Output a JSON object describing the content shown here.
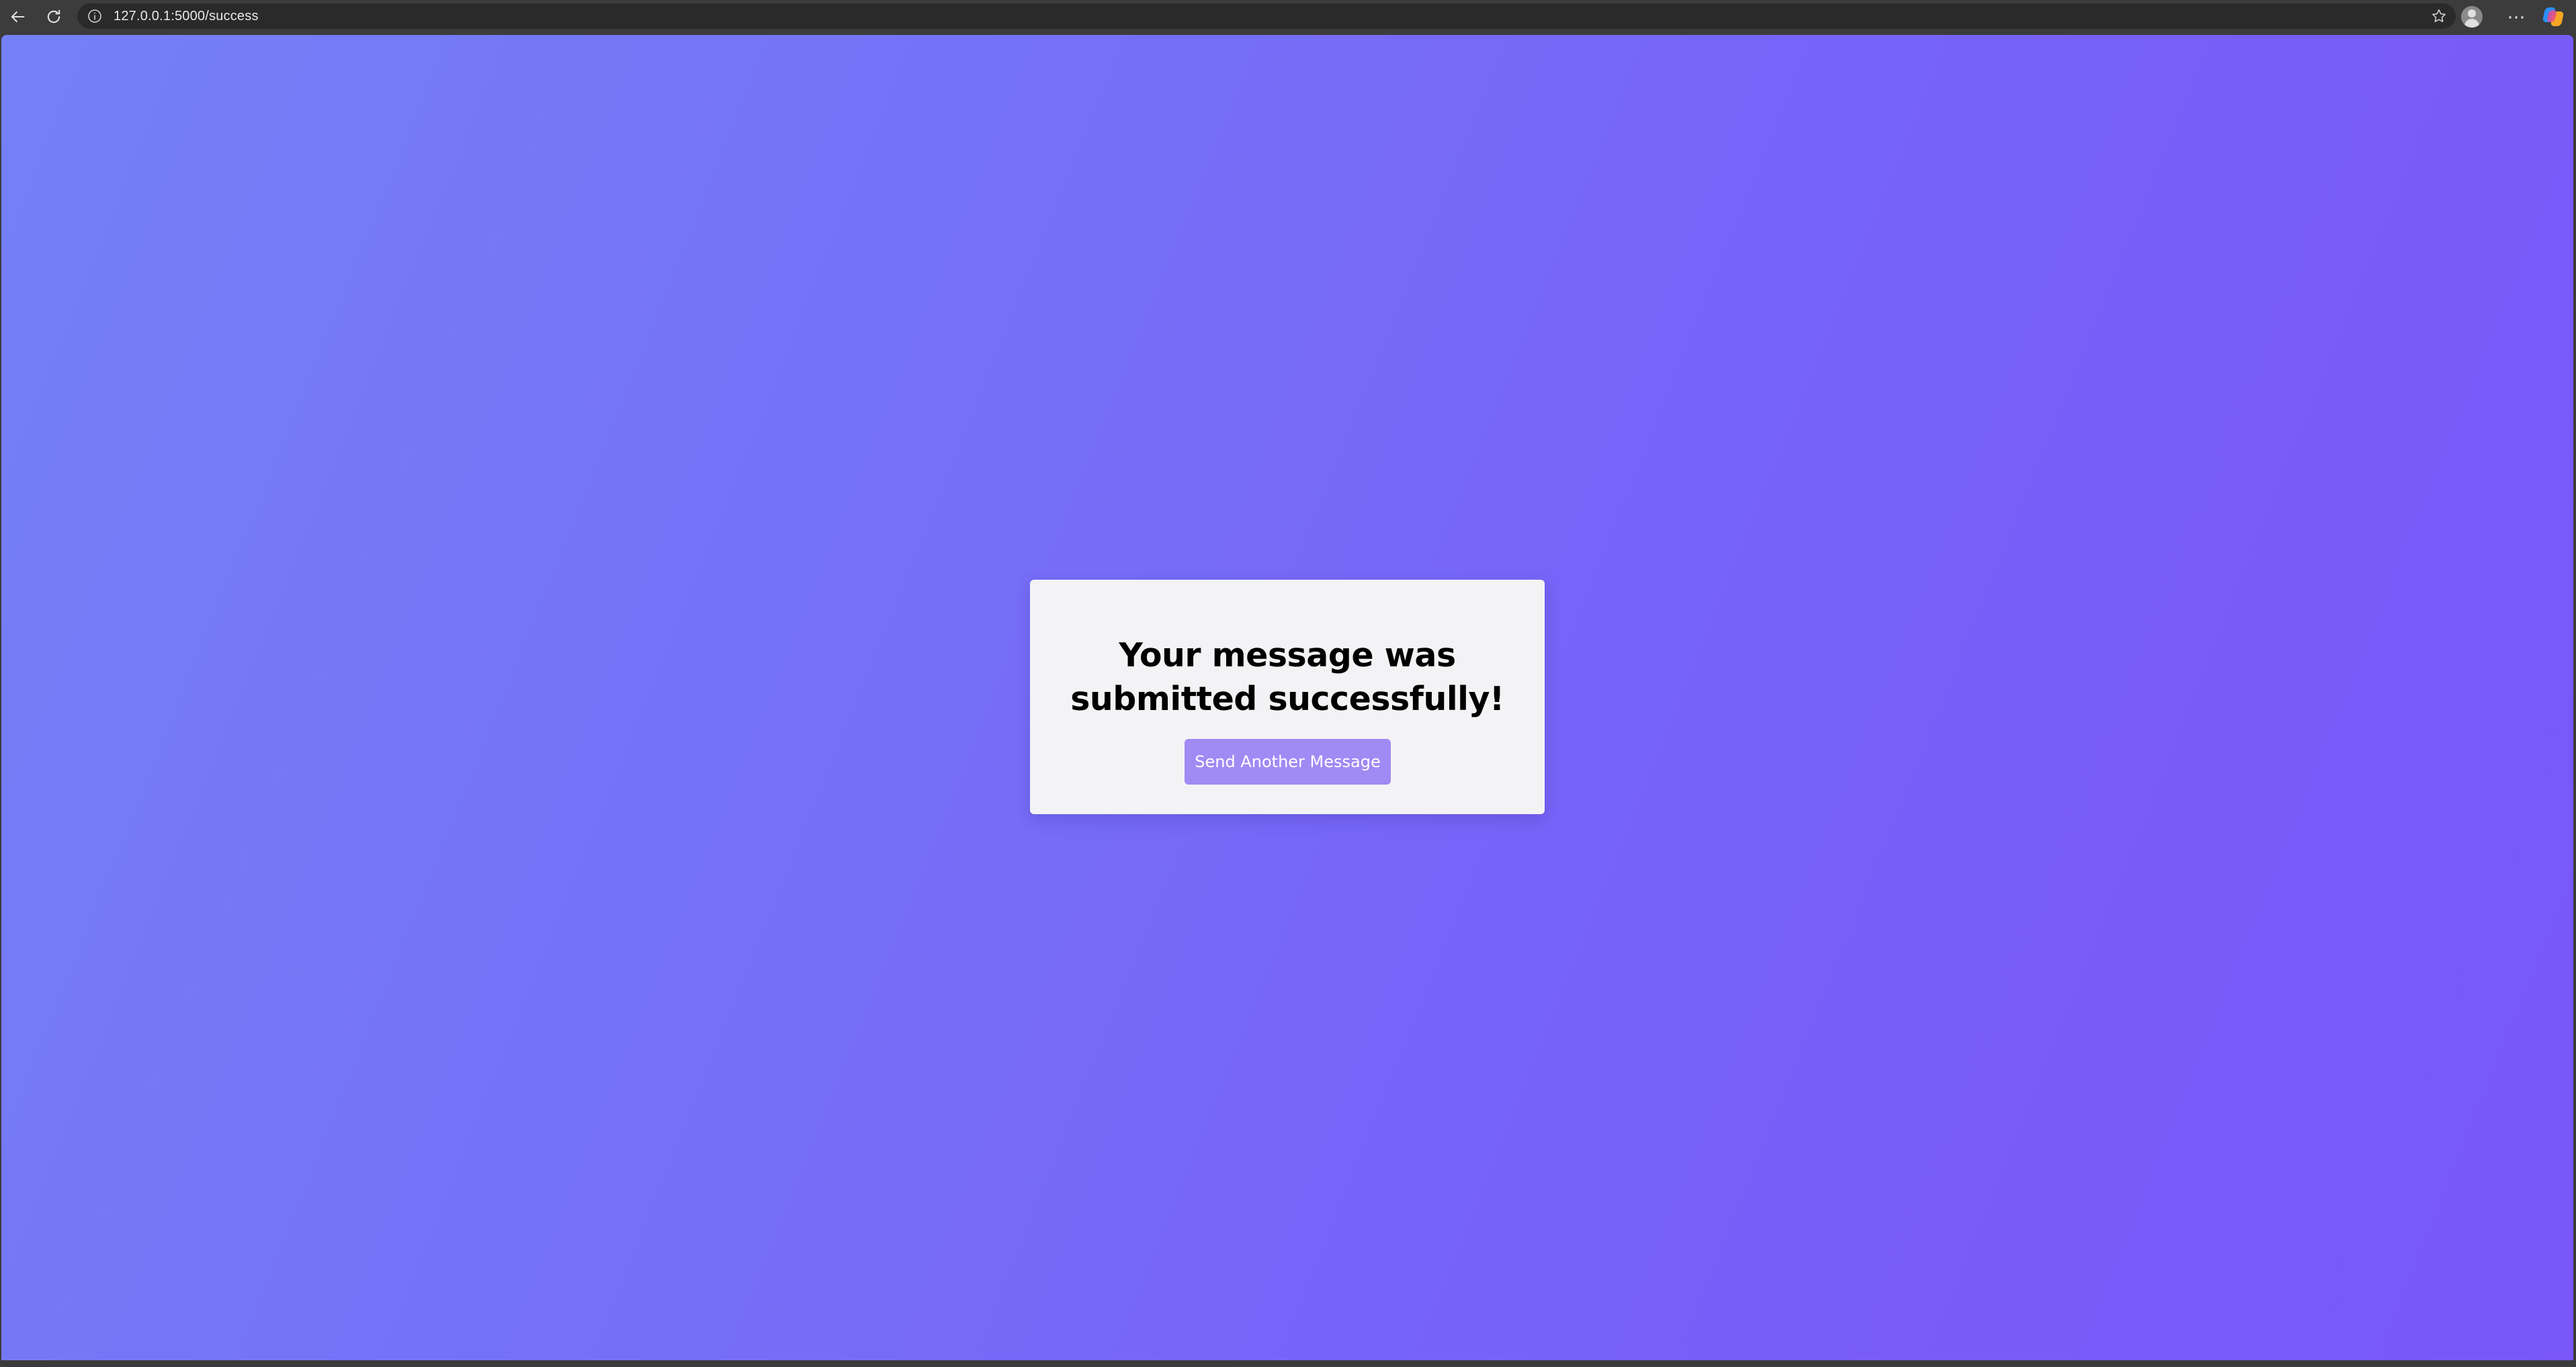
{
  "browser": {
    "url": "127.0.0.1:5000/success",
    "icons": {
      "back": "arrow-left-icon",
      "reload": "reload-icon",
      "site_info": "info-circle-icon",
      "favorite": "star-icon",
      "profile": "avatar",
      "menu": "more-horizontal-icon",
      "assistant": "copilot-icon"
    },
    "menu_glyph": "···"
  },
  "page": {
    "title": "Your message was submitted successfully!",
    "button_label": "Send Another Message"
  },
  "colors": {
    "gradient_start": "#7580f6",
    "gradient_end": "#7957f9",
    "card_background": "#f3f3f5",
    "button_background": "#a08af4",
    "button_text": "#ffffff",
    "title_text": "#000000"
  }
}
